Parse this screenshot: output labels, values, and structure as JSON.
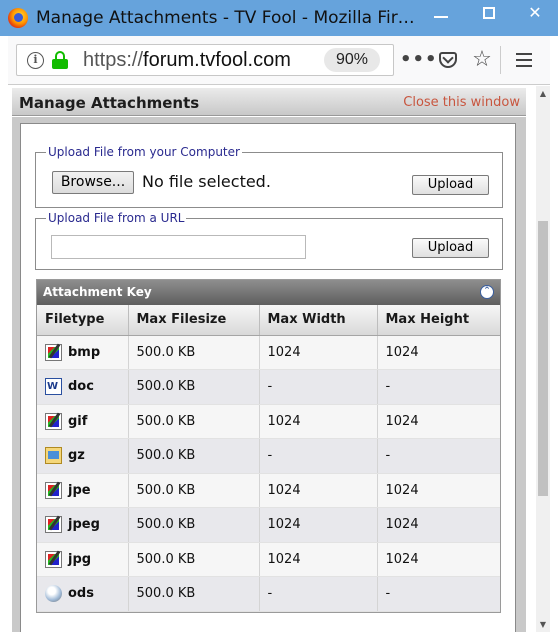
{
  "window": {
    "title": "Manage Attachments - TV Fool - Mozilla Fir…",
    "title_bar_color": "#66a3dc"
  },
  "browser": {
    "url_scheme": "https://",
    "url_domain": "forum.tvfool.com",
    "zoom": "90%",
    "more_label": "•••"
  },
  "page": {
    "title": "Manage Attachments",
    "close_link": "Close this window",
    "close_link_color": "#c8563f"
  },
  "upload_computer": {
    "legend": "Upload File from your Computer",
    "browse_label": "Browse...",
    "file_status": "No file selected.",
    "upload_label": "Upload"
  },
  "upload_url": {
    "legend": "Upload File from a URL",
    "input_value": "",
    "upload_label": "Upload"
  },
  "attachment_key": {
    "title": "Attachment Key",
    "columns": [
      "Filetype",
      "Max Filesize",
      "Max Width",
      "Max Height"
    ],
    "rows": [
      {
        "icon": "image-file-icon",
        "type": "bmp",
        "size": "500.0 KB",
        "width": "1024",
        "height": "1024"
      },
      {
        "icon": "word-document-icon",
        "type": "doc",
        "size": "500.0 KB",
        "width": "-",
        "height": "-"
      },
      {
        "icon": "image-file-icon",
        "type": "gif",
        "size": "500.0 KB",
        "width": "1024",
        "height": "1024"
      },
      {
        "icon": "archive-file-icon",
        "type": "gz",
        "size": "500.0 KB",
        "width": "-",
        "height": "-"
      },
      {
        "icon": "image-file-icon",
        "type": "jpe",
        "size": "500.0 KB",
        "width": "1024",
        "height": "1024"
      },
      {
        "icon": "image-file-icon",
        "type": "jpeg",
        "size": "500.0 KB",
        "width": "1024",
        "height": "1024"
      },
      {
        "icon": "image-file-icon",
        "type": "jpg",
        "size": "500.0 KB",
        "width": "1024",
        "height": "1024"
      },
      {
        "icon": "spreadsheet-file-icon",
        "type": "ods",
        "size": "500.0 KB",
        "width": "-",
        "height": "-"
      }
    ]
  }
}
